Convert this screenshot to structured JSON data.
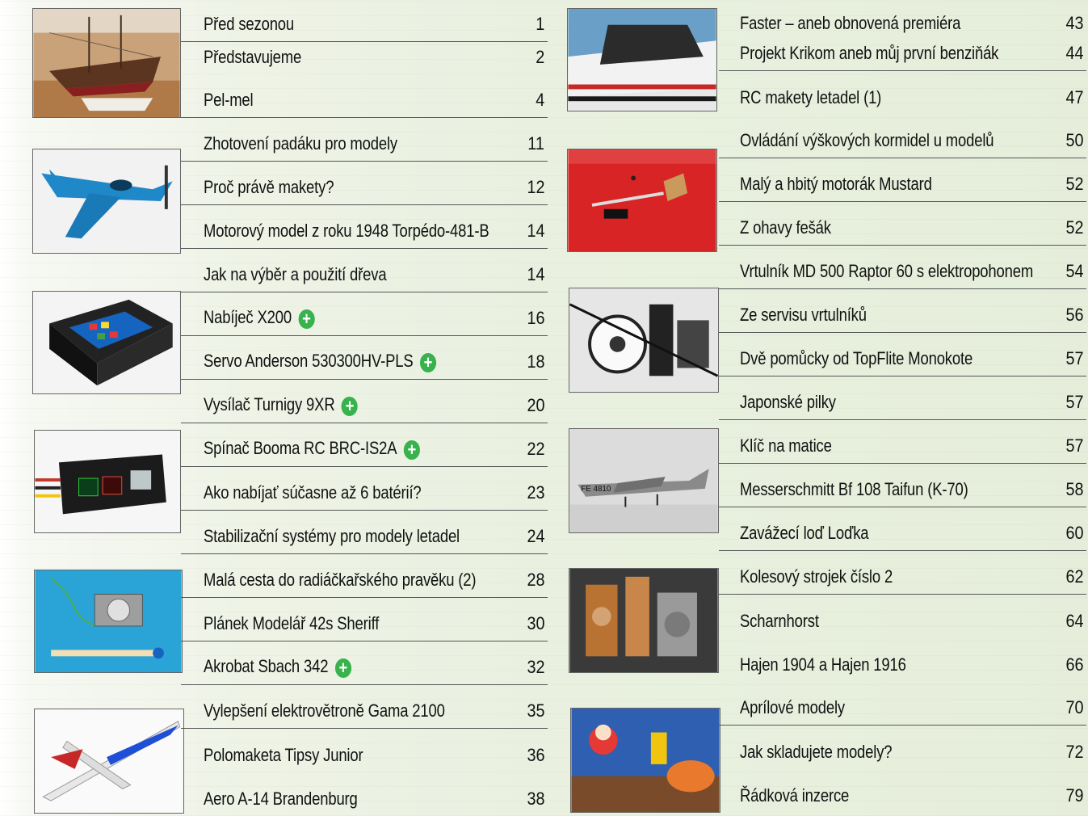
{
  "left_column": {
    "entries": [
      {
        "title": "Před sezonou",
        "page": "1",
        "new": false
      },
      {
        "title": "Představujeme",
        "page": "2",
        "new": false
      },
      {
        "title": "Pel-mel",
        "page": "4",
        "new": false
      },
      {
        "title": "Zhotovení padáku pro modely",
        "page": "11",
        "new": false
      },
      {
        "title": "Proč právě makety?",
        "page": "12",
        "new": false
      },
      {
        "title": "Motorový model z roku 1948 Torpédo-481-B",
        "page": "14",
        "new": false
      },
      {
        "title": "Jak na výběr a použití dřeva",
        "page": "14",
        "new": false
      },
      {
        "title": "Nabíječ X200",
        "page": "16",
        "new": true
      },
      {
        "title": "Servo Anderson 530300HV-PLS",
        "page": "18",
        "new": true
      },
      {
        "title": "Vysílač Turnigy 9XR",
        "page": "20",
        "new": true
      },
      {
        "title": "Spínač Booma RC BRC-IS2A",
        "page": "22",
        "new": true
      },
      {
        "title": "Ako nabíjať súčasne až 6 batérií?",
        "page": "23",
        "new": false
      },
      {
        "title": "Stabilizační systémy pro modely letadel",
        "page": "24",
        "new": false
      },
      {
        "title": "Malá cesta do radiáčkařského pravěku (2)",
        "page": "28",
        "new": false
      },
      {
        "title": "Plánek Modelář 42s Sheriff",
        "page": "30",
        "new": false
      },
      {
        "title": "Akrobat Sbach 342",
        "page": "32",
        "new": true
      },
      {
        "title": "Vylepšení elektrovětroně Gama 2100",
        "page": "35",
        "new": false
      },
      {
        "title": "Polomaketa Tipsy Junior",
        "page": "36",
        "new": false
      },
      {
        "title": "Aero A-14 Brandenburg",
        "page": "38",
        "new": false
      }
    ]
  },
  "right_column": {
    "entries": [
      {
        "title": "Faster – aneb obnovená premiéra",
        "page": "43",
        "new": false
      },
      {
        "title": "Projekt Krikom aneb můj první benziňák",
        "page": "44",
        "new": false
      },
      {
        "title": "RC makety letadel (1)",
        "page": "47",
        "new": false
      },
      {
        "title": "Ovládání výškových kormidel u modelů",
        "page": "50",
        "new": false
      },
      {
        "title": "Malý a hbitý motorák Mustard",
        "page": "52",
        "new": false
      },
      {
        "title": "Z ohavy fešák",
        "page": "52",
        "new": false
      },
      {
        "title": "Vrtulník MD 500 Raptor 60 s elektropohonem",
        "page": "54",
        "new": false
      },
      {
        "title": "Ze servisu vrtulníků",
        "page": "56",
        "new": false
      },
      {
        "title": "Dvě pomůcky od TopFlite Monokote",
        "page": "57",
        "new": false
      },
      {
        "title": "Japonské pilky",
        "page": "57",
        "new": false
      },
      {
        "title": "Klíč na matice",
        "page": "57",
        "new": false
      },
      {
        "title": "Messerschmitt Bf 108 Taifun (K-70)",
        "page": "58",
        "new": false
      },
      {
        "title": "Zavážecí loď Loďka",
        "page": "60",
        "new": false
      },
      {
        "title": "Kolesový strojek číslo 2",
        "page": "62",
        "new": false
      },
      {
        "title": "Scharnhorst",
        "page": "64",
        "new": false
      },
      {
        "title": "Hajen 1904 a Hajen 1916",
        "page": "66",
        "new": false
      },
      {
        "title": "Aprílové modely",
        "page": "70",
        "new": false
      },
      {
        "title": "Jak skladujete modely?",
        "page": "72",
        "new": false
      },
      {
        "title": "Řádková inzerce",
        "page": "79",
        "new": false
      }
    ]
  },
  "new_badge_symbol": "+",
  "photo_text": {
    "airplane_marking": "FE 4810"
  },
  "colors": {
    "accent_green": "#37b24d",
    "rule": "#555555"
  }
}
